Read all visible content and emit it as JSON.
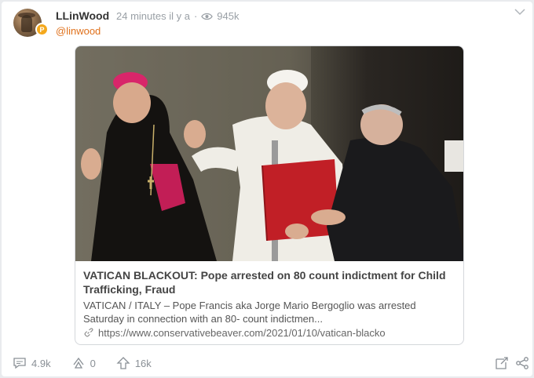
{
  "post": {
    "username": "LLinWood",
    "time": "24 minutes il y a",
    "separator": "·",
    "views": "945k",
    "handle": "@linwood",
    "badge": "P"
  },
  "link_preview": {
    "title": "VATICAN BLACKOUT: Pope arrested on 80 count indictment for Child Trafficking, Fraud",
    "description": "VATICAN / ITALY – Pope Francis aka Jorge Mario Bergoglio was arrested Saturday in connection with an 80- count indictmen...",
    "url": "https://www.conservativebeaver.com/2021/01/10/vatican-blacko"
  },
  "actions": {
    "comments": "4.9k",
    "reposts": "0",
    "upvotes": "16k"
  },
  "icons": {
    "views": "eye-icon",
    "chevron": "chevron-down-icon",
    "link": "link-icon",
    "comment": "comment-icon",
    "repost": "repost-icon",
    "upvote": "upvote-icon",
    "quote": "quote-icon",
    "share": "share-icon"
  },
  "colors": {
    "handle": "#e0711c",
    "badge": "#f4a81c",
    "muted": "#9aa0a6"
  }
}
